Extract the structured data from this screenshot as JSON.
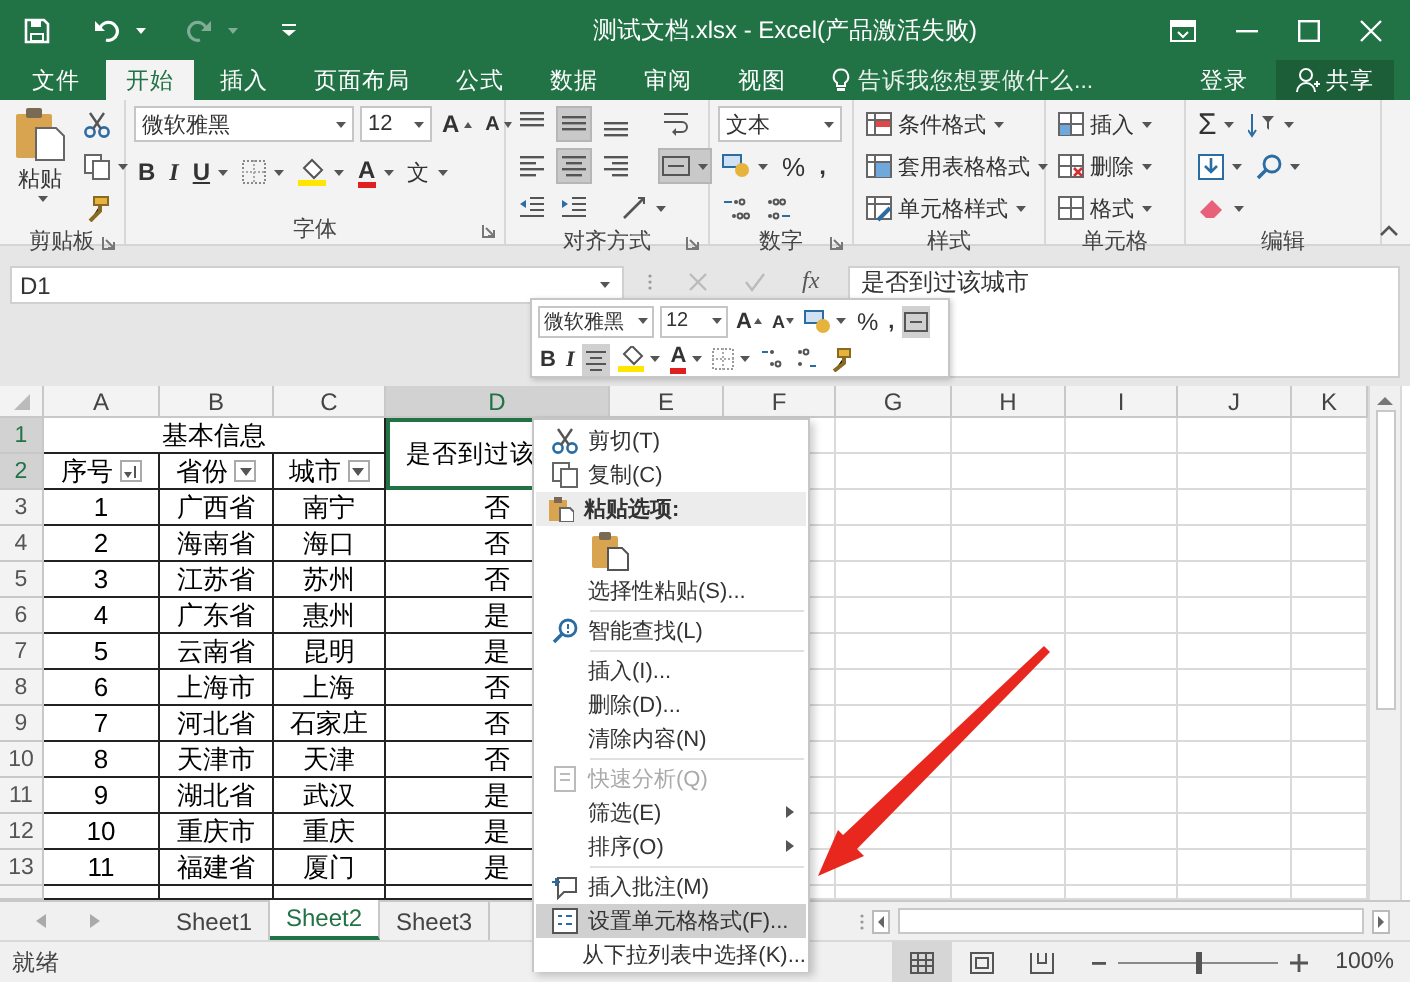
{
  "window": {
    "title": "测试文档.xlsx - Excel(产品激活失败)"
  },
  "ribbon_tabs": [
    {
      "label": "文件",
      "selected": false
    },
    {
      "label": "开始",
      "selected": true
    },
    {
      "label": "插入",
      "selected": false
    },
    {
      "label": "页面布局",
      "selected": false
    },
    {
      "label": "公式",
      "selected": false
    },
    {
      "label": "数据",
      "selected": false
    },
    {
      "label": "审阅",
      "selected": false
    },
    {
      "label": "视图",
      "selected": false
    }
  ],
  "tell_me": {
    "placeholder": "告诉我您想要做什么..."
  },
  "account": {
    "sign_in": "登录",
    "share": "共享"
  },
  "ribbon": {
    "clipboard": {
      "paste": "粘贴",
      "label": "剪贴板"
    },
    "font": {
      "label": "字体",
      "font_name": "微软雅黑",
      "font_size": "12",
      "grow": "A",
      "shrink": "A",
      "bold": "B",
      "italic": "I",
      "underline": "U",
      "font_color": "A",
      "phonetic": "文"
    },
    "alignment": {
      "label": "对齐方式",
      "buttons": [
        {
          "selected": false
        },
        {
          "selected": true
        },
        {
          "selected": false
        },
        {
          "selected": false
        },
        {
          "selected": true
        },
        {
          "selected": false
        },
        {
          "selected": true
        }
      ]
    },
    "number": {
      "label": "数字",
      "format": "文本",
      "percent": "%",
      "comma": ","
    },
    "styles": {
      "label": "样式",
      "items": [
        "条件格式",
        "套用表格格式",
        "单元格样式"
      ]
    },
    "cells": {
      "label": "单元格",
      "items": [
        "插入",
        "删除",
        "格式"
      ]
    },
    "editing": {
      "label": "编辑",
      "autosum": "Σ"
    }
  },
  "formula_bar": {
    "name_box": "D1",
    "fx": "fx",
    "formula": "是否到过该城市"
  },
  "sheet": {
    "columns": [
      {
        "label": "A",
        "selected": false
      },
      {
        "label": "B",
        "selected": false
      },
      {
        "label": "C",
        "selected": false
      },
      {
        "label": "D",
        "selected": true
      },
      {
        "label": "E",
        "selected": false
      },
      {
        "label": "F",
        "selected": false
      },
      {
        "label": "G",
        "selected": false
      },
      {
        "label": "H",
        "selected": false
      },
      {
        "label": "I",
        "selected": false
      },
      {
        "label": "J",
        "selected": false
      },
      {
        "label": "K",
        "selected": false
      }
    ],
    "header_rows": [
      {
        "number": "1",
        "selected": true
      },
      {
        "number": "2",
        "selected": true
      }
    ],
    "group_title": "基本信息",
    "header_cells": [
      {
        "text": "序号",
        "kind": "sorted"
      },
      {
        "text": "省份",
        "kind": "dropdown"
      },
      {
        "text": "城市",
        "kind": "dropdown"
      }
    ],
    "selected_cell": "是否到过该",
    "rows": [
      {
        "number": "3",
        "selected": false,
        "cells": [
          "1",
          "广西省",
          "南宁",
          "否"
        ]
      },
      {
        "number": "4",
        "selected": false,
        "cells": [
          "2",
          "海南省",
          "海口",
          "否"
        ]
      },
      {
        "number": "5",
        "selected": false,
        "cells": [
          "3",
          "江苏省",
          "苏州",
          "否"
        ]
      },
      {
        "number": "6",
        "selected": false,
        "cells": [
          "4",
          "广东省",
          "惠州",
          "是"
        ]
      },
      {
        "number": "7",
        "selected": false,
        "cells": [
          "5",
          "云南省",
          "昆明",
          "是"
        ]
      },
      {
        "number": "8",
        "selected": false,
        "cells": [
          "6",
          "上海市",
          "上海",
          "否"
        ]
      },
      {
        "number": "9",
        "selected": false,
        "cells": [
          "7",
          "河北省",
          "石家庄",
          "否"
        ]
      },
      {
        "number": "10",
        "selected": false,
        "cells": [
          "8",
          "天津市",
          "天津",
          "否"
        ]
      },
      {
        "number": "11",
        "selected": false,
        "cells": [
          "9",
          "湖北省",
          "武汉",
          "是"
        ]
      },
      {
        "number": "12",
        "selected": false,
        "cells": [
          "10",
          "重庆市",
          "重庆",
          "是"
        ]
      },
      {
        "number": "13",
        "selected": false,
        "cells": [
          "11",
          "福建省",
          "厦门",
          "是"
        ]
      }
    ]
  },
  "mini_toolbar": {
    "font_name": "微软雅黑",
    "font_size": "12",
    "grow": "A",
    "shrink": "A",
    "percent": "%",
    "comma": ",",
    "bold": "B",
    "italic": "I",
    "font_color": "A"
  },
  "context_menu": [
    {
      "kind": "item",
      "label": "剪切(T)",
      "disabled": false,
      "selected": false,
      "submenu": false
    },
    {
      "kind": "item",
      "label": "复制(C)",
      "disabled": false,
      "selected": false,
      "submenu": false
    },
    {
      "kind": "heading",
      "label": "粘贴选项:"
    },
    {
      "kind": "paste_icons"
    },
    {
      "kind": "item",
      "label": "选择性粘贴(S)...",
      "disabled": false,
      "selected": false,
      "submenu": false
    },
    {
      "kind": "separator"
    },
    {
      "kind": "item",
      "label": "智能查找(L)",
      "disabled": false,
      "selected": false,
      "submenu": false
    },
    {
      "kind": "separator"
    },
    {
      "kind": "item",
      "label": "插入(I)...",
      "disabled": false,
      "selected": false,
      "submenu": false
    },
    {
      "kind": "item",
      "label": "删除(D)...",
      "disabled": false,
      "selected": false,
      "submenu": false
    },
    {
      "kind": "item",
      "label": "清除内容(N)",
      "disabled": false,
      "selected": false,
      "submenu": false
    },
    {
      "kind": "separator"
    },
    {
      "kind": "item",
      "label": "快速分析(Q)",
      "disabled": true,
      "selected": false,
      "submenu": false
    },
    {
      "kind": "item",
      "label": "筛选(E)",
      "disabled": false,
      "selected": false,
      "submenu": true
    },
    {
      "kind": "item",
      "label": "排序(O)",
      "disabled": false,
      "selected": false,
      "submenu": true
    },
    {
      "kind": "separator"
    },
    {
      "kind": "item",
      "label": "插入批注(M)",
      "disabled": false,
      "selected": false,
      "submenu": false
    },
    {
      "kind": "item",
      "label": "设置单元格格式(F)...",
      "disabled": false,
      "selected": true,
      "submenu": false
    },
    {
      "kind": "item",
      "label": "从下拉列表中选择(K)...",
      "disabled": false,
      "selected": false,
      "submenu": false
    }
  ],
  "sheet_tabs": [
    {
      "label": "Sheet1",
      "selected": false
    },
    {
      "label": "Sheet2",
      "selected": true
    },
    {
      "label": "Sheet3",
      "selected": false
    }
  ],
  "status_bar": {
    "text": "就绪",
    "views": [
      {
        "selected": true
      },
      {
        "selected": false
      },
      {
        "selected": false
      }
    ],
    "zoom_slider": {
      "level": 0.5
    },
    "zoom": "100%"
  }
}
